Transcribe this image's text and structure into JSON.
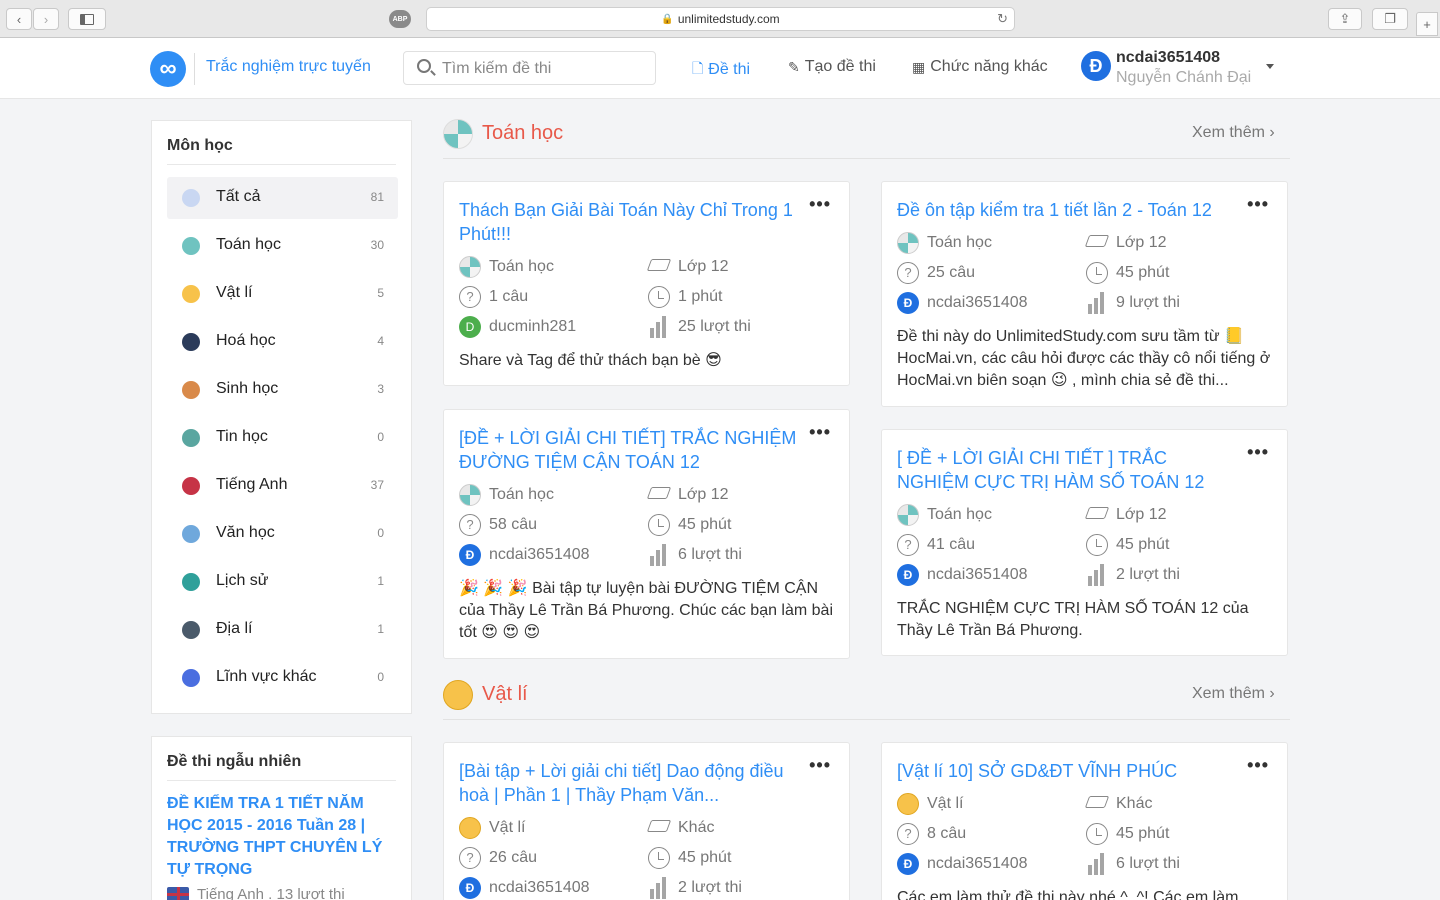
{
  "browser": {
    "url": "unlimitedstudy.com",
    "abp": "ABP"
  },
  "header": {
    "brand": "Trắc nghiệm trực tuyến",
    "search_placeholder": "Tìm kiếm đề thi",
    "nav": [
      "Đề thi",
      "Tạo đề thi",
      "Chức năng khác"
    ],
    "user": {
      "avatar_letter": "Đ",
      "username": "ncdai3651408",
      "full_name": "Nguyễn Chánh Đại"
    },
    "accent": "#2f8ef5"
  },
  "sidebar": {
    "title": "Môn học",
    "subjects": [
      {
        "label": "Tất cả",
        "count": "81",
        "color": "#c9d7f2"
      },
      {
        "label": "Toán học",
        "count": "30",
        "color": "#6fc3c0"
      },
      {
        "label": "Vật lí",
        "count": "5",
        "color": "#f7c24a"
      },
      {
        "label": "Hoá học",
        "count": "4",
        "color": "#2b3b5a"
      },
      {
        "label": "Sinh học",
        "count": "3",
        "color": "#d98a4a"
      },
      {
        "label": "Tin học",
        "count": "0",
        "color": "#5aa6a0"
      },
      {
        "label": "Tiếng Anh",
        "count": "37",
        "color": "#c63346"
      },
      {
        "label": "Văn học",
        "count": "0",
        "color": "#6fa8dc"
      },
      {
        "label": "Lịch sử",
        "count": "1",
        "color": "#2fa09a"
      },
      {
        "label": "Địa lí",
        "count": "1",
        "color": "#4a5a6a"
      },
      {
        "label": "Lĩnh vực khác",
        "count": "0",
        "color": "#4a6ee0"
      }
    ]
  },
  "random": {
    "title": "Đề thi ngẫu nhiên",
    "item_title": "ĐỀ KIỂM TRA 1 TIẾT NĂM HỌC 2015 - 2016 Tuần 28 | TRƯỜNG THPT CHUYÊN LÝ TỰ TRỌNG",
    "item_meta": "Tiếng Anh . 13 lượt thi"
  },
  "sections": [
    {
      "title": "Toán học",
      "more": "Xem thêm"
    },
    {
      "title": "Vật lí",
      "more": "Xem thêm"
    }
  ],
  "cards": [
    {
      "title": "Thách Bạn Giải Bài Toán Này Chỉ Trong 1 Phút!!!",
      "subject": "Toán học",
      "grade": "Lớp 12",
      "questions": "1 câu",
      "time": "1 phút",
      "author": "ducminh281",
      "author_letter": "D",
      "plays": "25 lượt thi",
      "desc": "Share và Tag để thử thách bạn bè 😎"
    },
    {
      "title": "Đề ôn tập kiểm tra 1 tiết lần 2 - Toán 12",
      "subject": "Toán học",
      "grade": "Lớp 12",
      "questions": "25 câu",
      "time": "45 phút",
      "author": "ncdai3651408",
      "author_letter": "Đ",
      "plays": "9 lượt thi",
      "desc": "Đề thi này do UnlimitedStudy.com sưu tầm từ 📒 HocMai.vn, các câu hỏi được các thầy cô nổi tiếng ở HocMai.vn biên soạn 😉 , mình chia sẻ đề thi..."
    },
    {
      "title": "[ĐỀ + LỜI GIẢI CHI TIẾT] TRẮC NGHIỆM ĐƯỜNG TIỆM CẬN TOÁN 12",
      "subject": "Toán học",
      "grade": "Lớp 12",
      "questions": "58 câu",
      "time": "45 phút",
      "author": "ncdai3651408",
      "author_letter": "Đ",
      "plays": "6 lượt thi",
      "desc": "🎉 🎉 🎉 Bài tập tự luyện bài ĐƯỜNG TIỆM CẬN của Thầy Lê Trần Bá Phương. Chúc các bạn làm bài tốt 😍 😍 😍"
    },
    {
      "title": "[ ĐỀ + LỜI GIẢI CHI TIẾT ] TRẮC NGHIỆM CỰC TRỊ HÀM SỐ TOÁN 12",
      "subject": "Toán học",
      "grade": "Lớp 12",
      "questions": "41 câu",
      "time": "45 phút",
      "author": "ncdai3651408",
      "author_letter": "Đ",
      "plays": "2 lượt thi",
      "desc": "TRẮC NGHIỆM CỰC TRỊ HÀM SỐ TOÁN 12 của Thầy Lê Trần Bá Phương."
    },
    {
      "title": "[Bài tập + Lời giải chi tiết] Dao động điều hoà | Phần 1 | Thầy Phạm Văn...",
      "subject": "Vật lí",
      "grade": "Khác",
      "questions": "26 câu",
      "time": "45 phút",
      "author": "ncdai3651408",
      "author_letter": "Đ",
      "plays": "2 lượt thi",
      "desc": ""
    },
    {
      "title": "[Vật lí 10] SỞ GD&ĐT VĨNH PHÚC",
      "subject": "Vật lí",
      "grade": "Khác",
      "questions": "8 câu",
      "time": "45 phút",
      "author": "ncdai3651408",
      "author_letter": "Đ",
      "plays": "6 lượt thi",
      "desc": "Các em làm thử đề thi này nhé ^_^! Các em làm"
    }
  ]
}
